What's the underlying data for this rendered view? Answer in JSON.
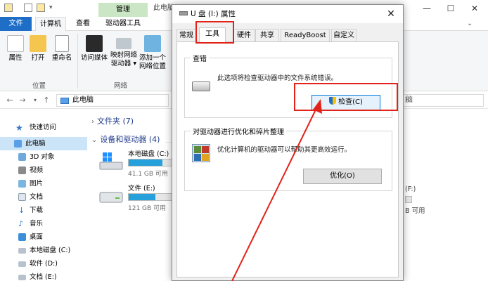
{
  "explorer": {
    "manage_tab": "管理",
    "title": "此电脑",
    "window_buttons": {
      "minimize": "—",
      "maximize": "☐",
      "close": "✕"
    },
    "ribbon_tabs": [
      "文件",
      "计算机",
      "查看",
      "驱动器工具"
    ],
    "ribbon_buttons": [
      {
        "label": "属性",
        "icon": "properties-icon"
      },
      {
        "label": "打开",
        "icon": "open-folder-icon"
      },
      {
        "label": "重命名",
        "icon": "rename-icon"
      },
      {
        "label": "访问媒体",
        "icon": "media-icon"
      },
      {
        "label": "映射网络驱动器",
        "icon": "map-drive-icon"
      },
      {
        "label": "添加一个网络位置",
        "icon": "network-location-icon"
      }
    ],
    "ribbon_groups": [
      "位置",
      "网络"
    ],
    "address": "此电脑",
    "search_placeholder": "脑",
    "nav_items": [
      {
        "label": "快速访问",
        "icon": "star-icon"
      },
      {
        "label": "此电脑",
        "icon": "pc-icon",
        "selected": true
      },
      {
        "label": "3D 对象",
        "icon": "3d-objects-icon"
      },
      {
        "label": "视频",
        "icon": "videos-icon"
      },
      {
        "label": "图片",
        "icon": "pictures-icon"
      },
      {
        "label": "文档",
        "icon": "documents-icon"
      },
      {
        "label": "下载",
        "icon": "downloads-icon"
      },
      {
        "label": "音乐",
        "icon": "music-icon"
      },
      {
        "label": "桌面",
        "icon": "desktop-icon"
      },
      {
        "label": "本地磁盘 (C:)",
        "icon": "drive-c-icon"
      },
      {
        "label": "软件 (D:)",
        "icon": "drive-d-icon"
      },
      {
        "label": "文档 (E:)",
        "icon": "drive-e-icon"
      }
    ],
    "sections": {
      "folders": "文件夹 (7)",
      "devices": "设备和驱动器 (4)"
    },
    "drives": [
      {
        "name": "本地磁盘 (C:)",
        "free": "41.1 GB 可用",
        "used_fraction": 0.78
      },
      {
        "name": "文件 (E:)",
        "free": "121 GB 可用",
        "used_fraction": 0.62
      }
    ],
    "right_text": [
      "ì",
      "(F:)",
      "B 可用"
    ]
  },
  "dialog": {
    "title": "U 盘 (I:) 属性",
    "close": "✕",
    "tabs": [
      "常规",
      "工具",
      "硬件",
      "共享",
      "ReadyBoost",
      "自定义"
    ],
    "active_tab": "工具",
    "error_check": {
      "title": "查错",
      "desc": "此选项将检查驱动器中的文件系统错误。",
      "button": "检查(C)"
    },
    "optimize": {
      "title": "对驱动器进行优化和碎片整理",
      "desc": "优化计算机的驱动器可以帮助其更高效运行。",
      "button": "优化(O)"
    }
  },
  "colors": {
    "accent": "#1e6ec8",
    "highlight_red": "#e2231a",
    "manage_green": "#cbe6c4",
    "drive_bar": "#26a0da"
  }
}
